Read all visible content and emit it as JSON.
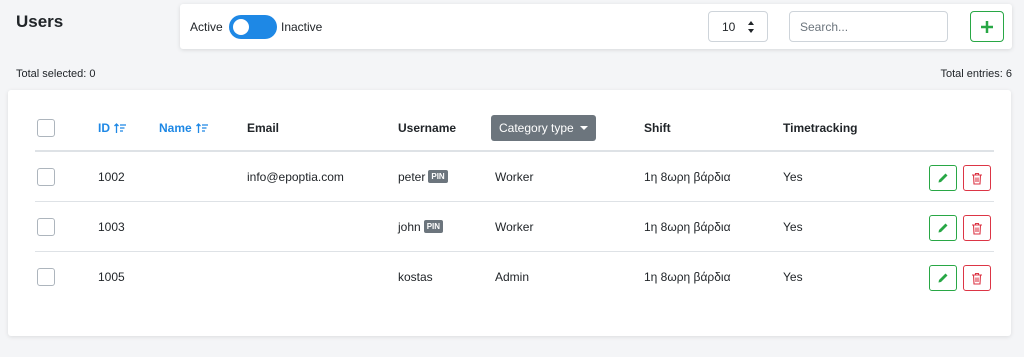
{
  "page": {
    "title": "Users"
  },
  "toolbar": {
    "active_label": "Active",
    "inactive_label": "Inactive",
    "page_size": "10",
    "search_placeholder": "Search..."
  },
  "summary": {
    "total_selected": "Total selected: 0",
    "total_entries": "Total entries: 6"
  },
  "table": {
    "headers": {
      "id": "ID",
      "name": "Name",
      "email": "Email",
      "username": "Username",
      "category": "Category type",
      "shift": "Shift",
      "timetracking": "Timetracking"
    },
    "pin_label": "PIN",
    "rows": [
      {
        "id": "1002",
        "name": "",
        "email": "info@epoptia.com",
        "username": "peter",
        "category": "Worker",
        "shift": "1η 8ωρη βάρδια",
        "timetracking": "Yes"
      },
      {
        "id": "1003",
        "name": "",
        "email": "",
        "username": "john",
        "category": "Worker",
        "shift": "1η 8ωρη βάρδια",
        "timetracking": "Yes"
      },
      {
        "id": "1005",
        "name": "",
        "email": "",
        "username": "kostas",
        "category": "Admin",
        "shift": "1η 8ωρη βάρδια",
        "timetracking": "Yes"
      }
    ]
  },
  "colors": {
    "primary": "#1e88e5",
    "success": "#28a745",
    "danger": "#dc3545",
    "secondary": "#6c757d"
  }
}
